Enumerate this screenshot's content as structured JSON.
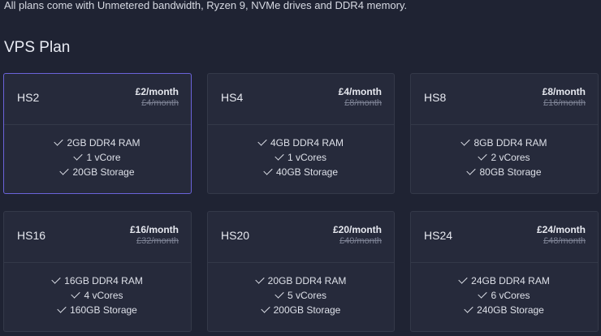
{
  "header": {
    "subtitle": "All plans come with Unmetered bandwidth, Ryzen 9, NVMe drives and DDR4 memory."
  },
  "section": {
    "title": "VPS Plan"
  },
  "plans": [
    {
      "name": "HS2",
      "price": "£2/month",
      "old_price": "£4/month",
      "features": [
        "2GB DDR4 RAM",
        "1 vCore",
        "20GB Storage"
      ],
      "selected": true
    },
    {
      "name": "HS4",
      "price": "£4/month",
      "old_price": "£8/month",
      "features": [
        "4GB DDR4 RAM",
        "1 vCores",
        "40GB Storage"
      ],
      "selected": false
    },
    {
      "name": "HS8",
      "price": "£8/month",
      "old_price": "£16/month",
      "features": [
        "8GB DDR4 RAM",
        "2 vCores",
        "80GB Storage"
      ],
      "selected": false
    },
    {
      "name": "HS16",
      "price": "£16/month",
      "old_price": "£32/month",
      "features": [
        "16GB DDR4 RAM",
        "4 vCores",
        "160GB Storage"
      ],
      "selected": false
    },
    {
      "name": "HS20",
      "price": "£20/month",
      "old_price": "£40/month",
      "features": [
        "20GB DDR4 RAM",
        "5 vCores",
        "200GB Storage"
      ],
      "selected": false
    },
    {
      "name": "HS24",
      "price": "£24/month",
      "old_price": "£48/month",
      "features": [
        "24GB DDR4 RAM",
        "6 vCores",
        "240GB Storage"
      ],
      "selected": false
    }
  ],
  "icons": {
    "feature": "check-icon"
  },
  "colors": {
    "background": "#1f2333",
    "card": "#262a3b",
    "card_border": "#343949",
    "selected_border": "#6a63d9",
    "muted_text": "#7d8294"
  }
}
